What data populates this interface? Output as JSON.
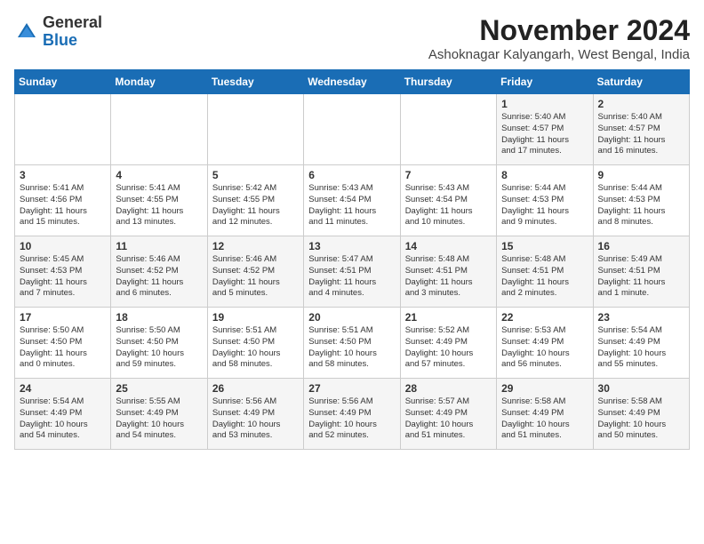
{
  "logo": {
    "general": "General",
    "blue": "Blue"
  },
  "title": "November 2024",
  "subtitle": "Ashoknagar Kalyangarh, West Bengal, India",
  "headers": [
    "Sunday",
    "Monday",
    "Tuesday",
    "Wednesday",
    "Thursday",
    "Friday",
    "Saturday"
  ],
  "weeks": [
    [
      {
        "day": "",
        "info": ""
      },
      {
        "day": "",
        "info": ""
      },
      {
        "day": "",
        "info": ""
      },
      {
        "day": "",
        "info": ""
      },
      {
        "day": "",
        "info": ""
      },
      {
        "day": "1",
        "info": "Sunrise: 5:40 AM\nSunset: 4:57 PM\nDaylight: 11 hours\nand 17 minutes."
      },
      {
        "day": "2",
        "info": "Sunrise: 5:40 AM\nSunset: 4:57 PM\nDaylight: 11 hours\nand 16 minutes."
      }
    ],
    [
      {
        "day": "3",
        "info": "Sunrise: 5:41 AM\nSunset: 4:56 PM\nDaylight: 11 hours\nand 15 minutes."
      },
      {
        "day": "4",
        "info": "Sunrise: 5:41 AM\nSunset: 4:55 PM\nDaylight: 11 hours\nand 13 minutes."
      },
      {
        "day": "5",
        "info": "Sunrise: 5:42 AM\nSunset: 4:55 PM\nDaylight: 11 hours\nand 12 minutes."
      },
      {
        "day": "6",
        "info": "Sunrise: 5:43 AM\nSunset: 4:54 PM\nDaylight: 11 hours\nand 11 minutes."
      },
      {
        "day": "7",
        "info": "Sunrise: 5:43 AM\nSunset: 4:54 PM\nDaylight: 11 hours\nand 10 minutes."
      },
      {
        "day": "8",
        "info": "Sunrise: 5:44 AM\nSunset: 4:53 PM\nDaylight: 11 hours\nand 9 minutes."
      },
      {
        "day": "9",
        "info": "Sunrise: 5:44 AM\nSunset: 4:53 PM\nDaylight: 11 hours\nand 8 minutes."
      }
    ],
    [
      {
        "day": "10",
        "info": "Sunrise: 5:45 AM\nSunset: 4:53 PM\nDaylight: 11 hours\nand 7 minutes."
      },
      {
        "day": "11",
        "info": "Sunrise: 5:46 AM\nSunset: 4:52 PM\nDaylight: 11 hours\nand 6 minutes."
      },
      {
        "day": "12",
        "info": "Sunrise: 5:46 AM\nSunset: 4:52 PM\nDaylight: 11 hours\nand 5 minutes."
      },
      {
        "day": "13",
        "info": "Sunrise: 5:47 AM\nSunset: 4:51 PM\nDaylight: 11 hours\nand 4 minutes."
      },
      {
        "day": "14",
        "info": "Sunrise: 5:48 AM\nSunset: 4:51 PM\nDaylight: 11 hours\nand 3 minutes."
      },
      {
        "day": "15",
        "info": "Sunrise: 5:48 AM\nSunset: 4:51 PM\nDaylight: 11 hours\nand 2 minutes."
      },
      {
        "day": "16",
        "info": "Sunrise: 5:49 AM\nSunset: 4:51 PM\nDaylight: 11 hours\nand 1 minute."
      }
    ],
    [
      {
        "day": "17",
        "info": "Sunrise: 5:50 AM\nSunset: 4:50 PM\nDaylight: 11 hours\nand 0 minutes."
      },
      {
        "day": "18",
        "info": "Sunrise: 5:50 AM\nSunset: 4:50 PM\nDaylight: 10 hours\nand 59 minutes."
      },
      {
        "day": "19",
        "info": "Sunrise: 5:51 AM\nSunset: 4:50 PM\nDaylight: 10 hours\nand 58 minutes."
      },
      {
        "day": "20",
        "info": "Sunrise: 5:51 AM\nSunset: 4:50 PM\nDaylight: 10 hours\nand 58 minutes."
      },
      {
        "day": "21",
        "info": "Sunrise: 5:52 AM\nSunset: 4:49 PM\nDaylight: 10 hours\nand 57 minutes."
      },
      {
        "day": "22",
        "info": "Sunrise: 5:53 AM\nSunset: 4:49 PM\nDaylight: 10 hours\nand 56 minutes."
      },
      {
        "day": "23",
        "info": "Sunrise: 5:54 AM\nSunset: 4:49 PM\nDaylight: 10 hours\nand 55 minutes."
      }
    ],
    [
      {
        "day": "24",
        "info": "Sunrise: 5:54 AM\nSunset: 4:49 PM\nDaylight: 10 hours\nand 54 minutes."
      },
      {
        "day": "25",
        "info": "Sunrise: 5:55 AM\nSunset: 4:49 PM\nDaylight: 10 hours\nand 54 minutes."
      },
      {
        "day": "26",
        "info": "Sunrise: 5:56 AM\nSunset: 4:49 PM\nDaylight: 10 hours\nand 53 minutes."
      },
      {
        "day": "27",
        "info": "Sunrise: 5:56 AM\nSunset: 4:49 PM\nDaylight: 10 hours\nand 52 minutes."
      },
      {
        "day": "28",
        "info": "Sunrise: 5:57 AM\nSunset: 4:49 PM\nDaylight: 10 hours\nand 51 minutes."
      },
      {
        "day": "29",
        "info": "Sunrise: 5:58 AM\nSunset: 4:49 PM\nDaylight: 10 hours\nand 51 minutes."
      },
      {
        "day": "30",
        "info": "Sunrise: 5:58 AM\nSunset: 4:49 PM\nDaylight: 10 hours\nand 50 minutes."
      }
    ]
  ]
}
